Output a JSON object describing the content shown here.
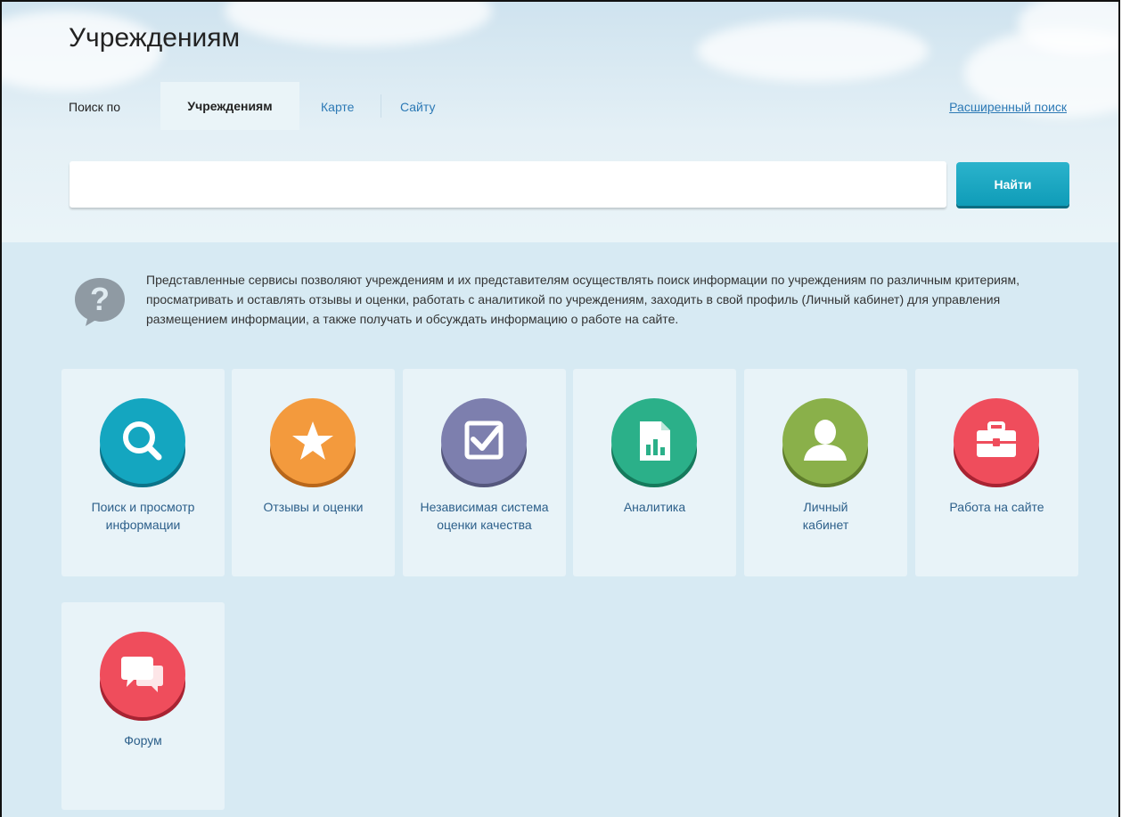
{
  "header": {
    "title": "Учреждениям",
    "tabs_lead": "Поиск по",
    "tabs": [
      {
        "label": "Учреждениям",
        "active": true
      },
      {
        "label": "Карте",
        "active": false
      },
      {
        "label": "Сайту",
        "active": false
      }
    ],
    "advanced_search": "Расширенный поиск"
  },
  "search": {
    "value": "",
    "placeholder": "",
    "button_label": "Найти"
  },
  "info": {
    "icon": "question-bubble-icon",
    "text": "Представленные сервисы позволяют учреждениям и их представителям осуществлять поиск информации по учреждениям по различным критериям, просматривать и оставлять отзывы и оценки, работать с аналитикой по учреждениям, заходить в свой профиль (Личный кабинет) для управления размещением информации, а также получать и обсуждать информацию о работе на сайте."
  },
  "services": [
    {
      "label": "Поиск и просмотр информации",
      "icon": "search-icon",
      "color": "#14a6c0"
    },
    {
      "label": "Отзывы и оценки",
      "icon": "star-icon",
      "color": "#f39a3d"
    },
    {
      "label": "Независимая система оценки качества",
      "icon": "checkbox-icon",
      "color": "#7d7fae"
    },
    {
      "label": "Аналитика",
      "icon": "analytics-document-icon",
      "color": "#2bb089"
    },
    {
      "label": "Личный кабинет",
      "icon": "user-icon",
      "color": "#8ab04a"
    },
    {
      "label": "Работа на сайте",
      "icon": "briefcase-icon",
      "color": "#ef4d5c"
    },
    {
      "label": "Форум",
      "icon": "chat-bubbles-icon",
      "color": "#ef4d5c"
    }
  ]
}
